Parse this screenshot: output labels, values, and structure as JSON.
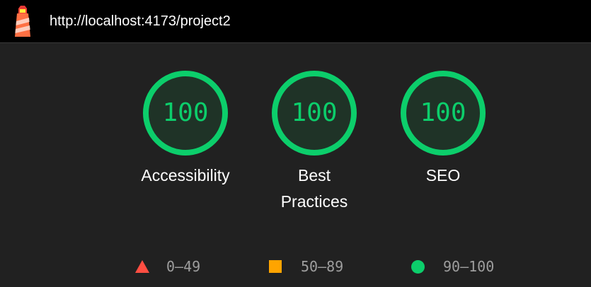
{
  "header": {
    "url": "http://localhost:4173/project2"
  },
  "gauges": [
    {
      "score": "100",
      "label": "Accessibility"
    },
    {
      "score": "100",
      "label": "Best Practices"
    },
    {
      "score": "100",
      "label": "SEO"
    }
  ],
  "legend": [
    {
      "shape": "triangle",
      "range": "0–49"
    },
    {
      "shape": "square",
      "range": "50–89"
    },
    {
      "shape": "circle",
      "range": "90–100"
    }
  ],
  "colors": {
    "pass": "#0cce6b",
    "average": "#ffa400",
    "fail": "#ff4e42",
    "background": "#212121",
    "header": "#000000"
  },
  "icons": {
    "logo": "lighthouse-logo-icon"
  }
}
